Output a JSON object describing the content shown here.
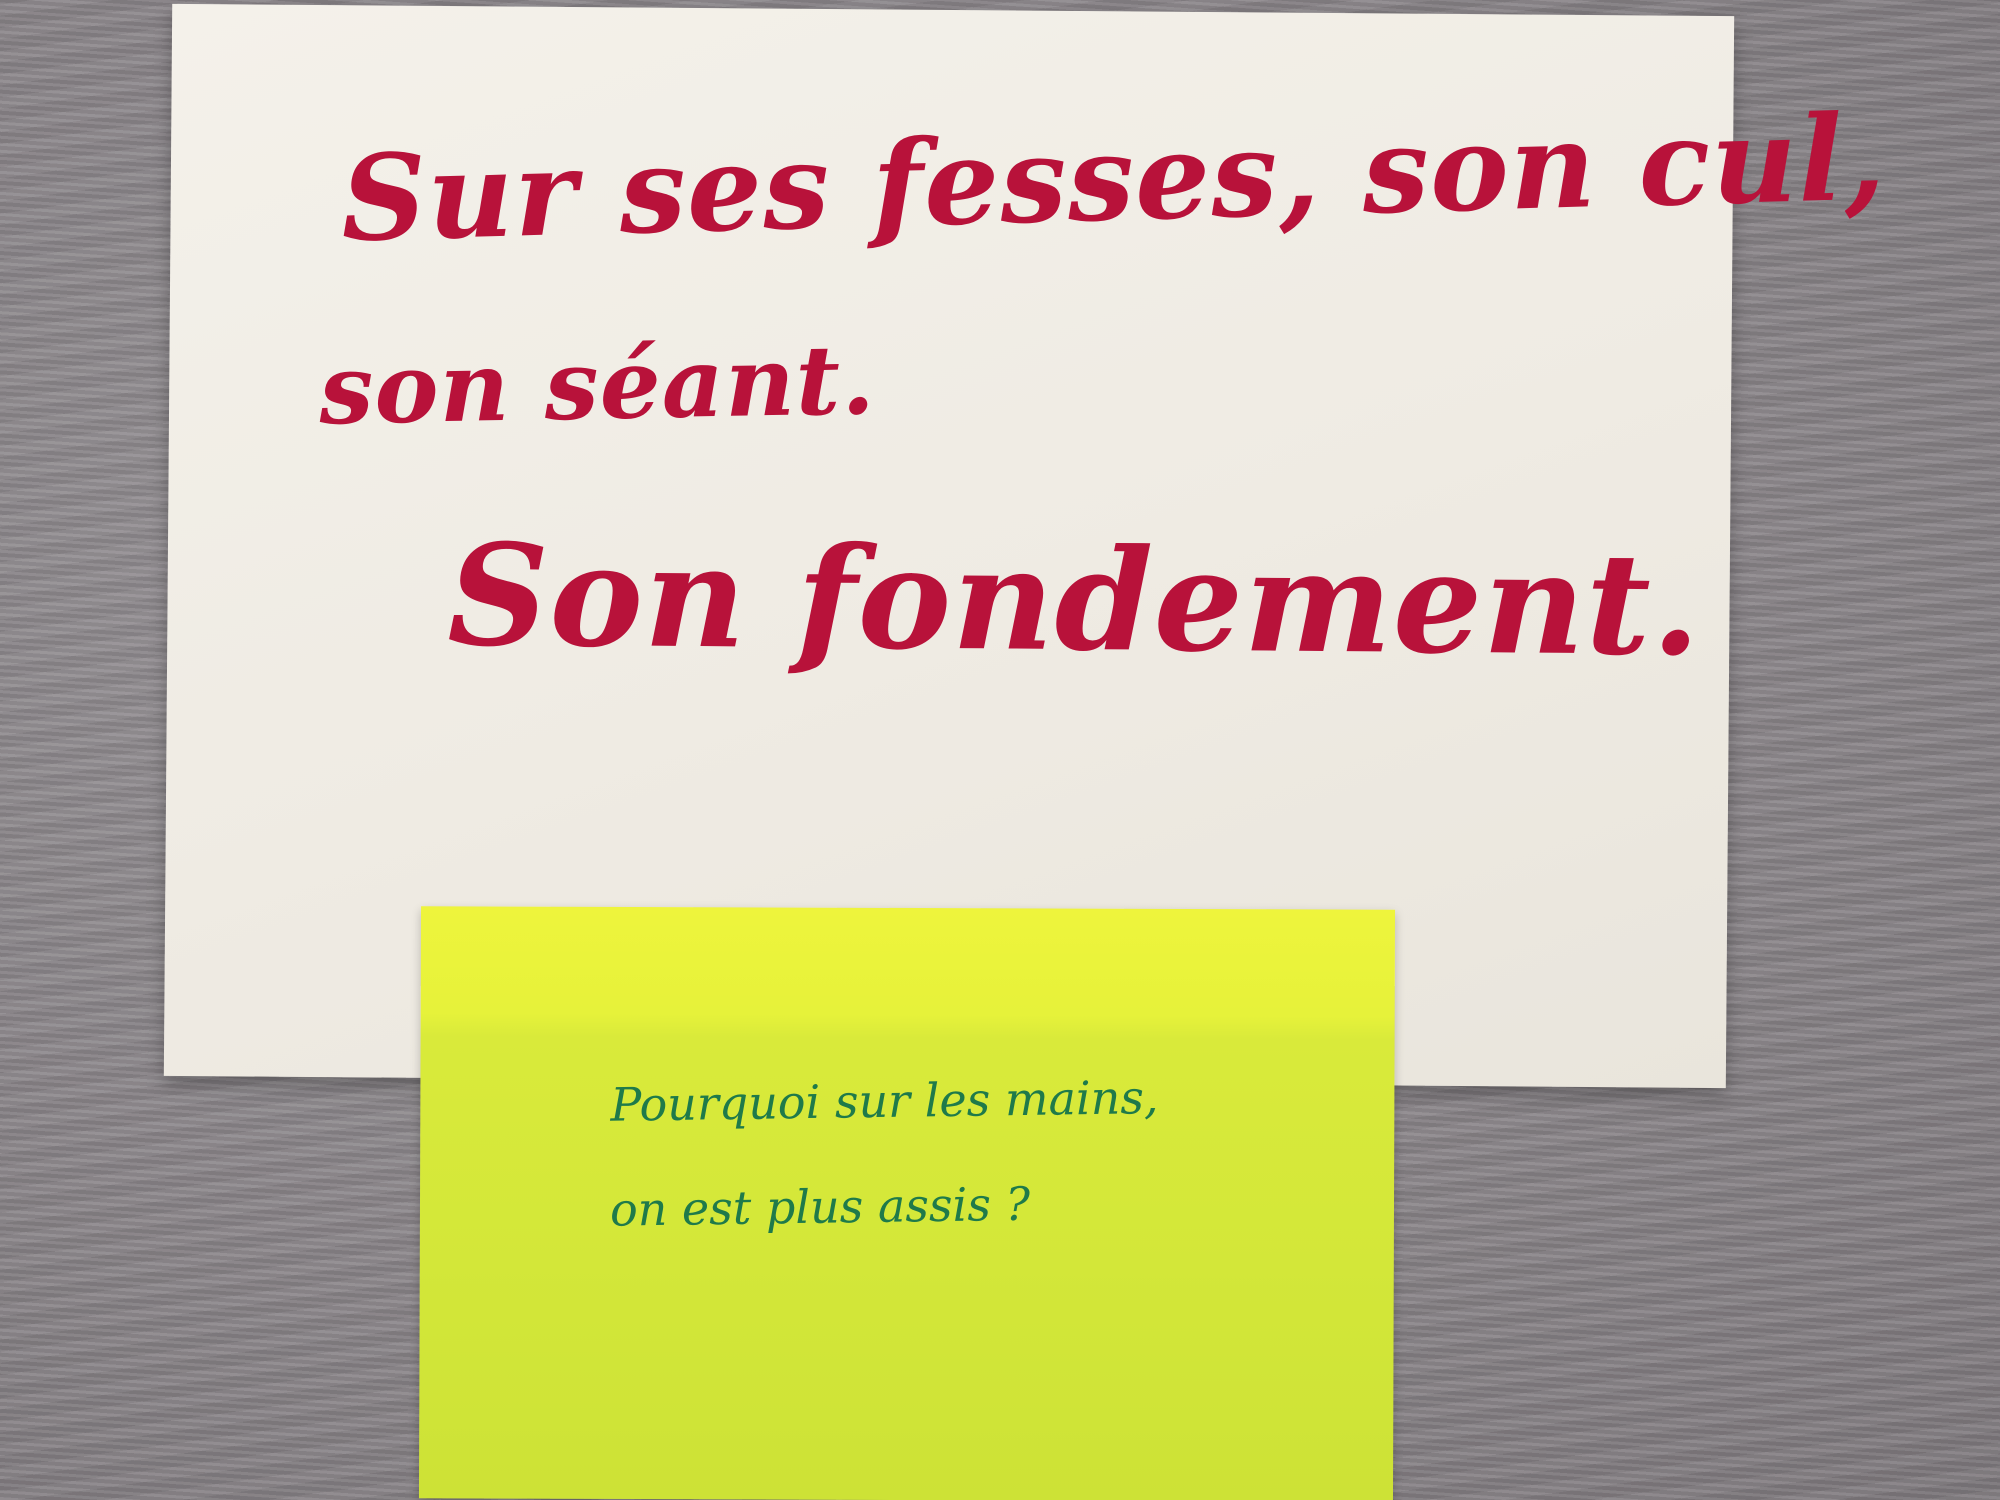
{
  "image": {
    "subject": "handwritten-notes"
  },
  "paper_note": {
    "lines": [
      "Sur ses fesses, son cul,",
      "son séant.",
      "Son fondement."
    ],
    "ink_color": "#b8123a"
  },
  "sticky_note": {
    "lines": [
      "Pourquoi sur les mains,",
      "on est plus assis ?"
    ],
    "ink_color": "#1f7a4a",
    "paper_color": "#d9ea3a"
  },
  "background_color": "#8f8a8e"
}
